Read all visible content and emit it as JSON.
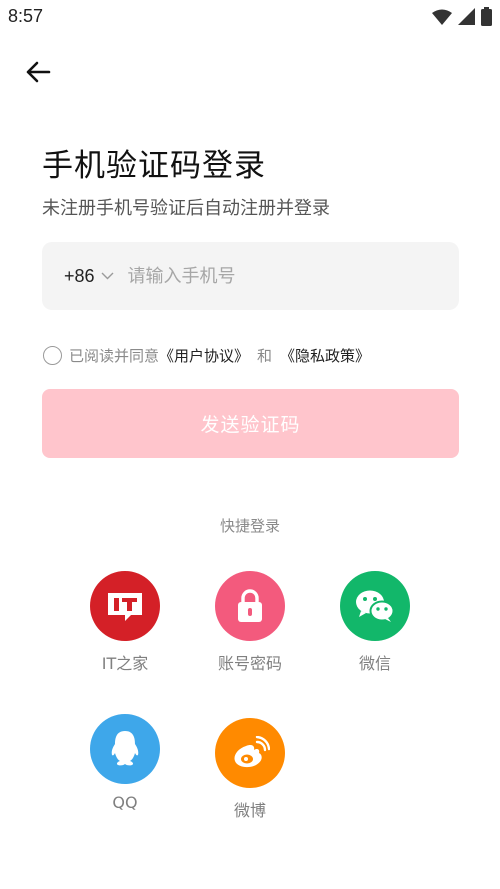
{
  "status": {
    "time": "8:57"
  },
  "header": {
    "title": "手机验证码登录",
    "subtitle": "未注册手机号验证后自动注册并登录"
  },
  "phone": {
    "country_code": "+86",
    "placeholder": "请输入手机号",
    "value": ""
  },
  "agreement": {
    "prefix": "已阅读并同意",
    "user_agreement": "《用户协议》",
    "and": "和",
    "privacy_policy": "《隐私政策》",
    "checked": false
  },
  "send_button": {
    "label": "发送验证码",
    "color": "#ffc5cc"
  },
  "quick_login": {
    "label": "快捷登录",
    "options": [
      {
        "label": "IT之家",
        "icon": "ithome-icon",
        "color": "#d42027"
      },
      {
        "label": "账号密码",
        "icon": "lock-icon",
        "color": "#f35a7d"
      },
      {
        "label": "微信",
        "icon": "wechat-icon",
        "color": "#12b76a"
      },
      {
        "label": "QQ",
        "icon": "qq-icon",
        "color": "#3ea7ea"
      },
      {
        "label": "微博",
        "icon": "weibo-icon",
        "color": "#ff8a00"
      }
    ]
  }
}
